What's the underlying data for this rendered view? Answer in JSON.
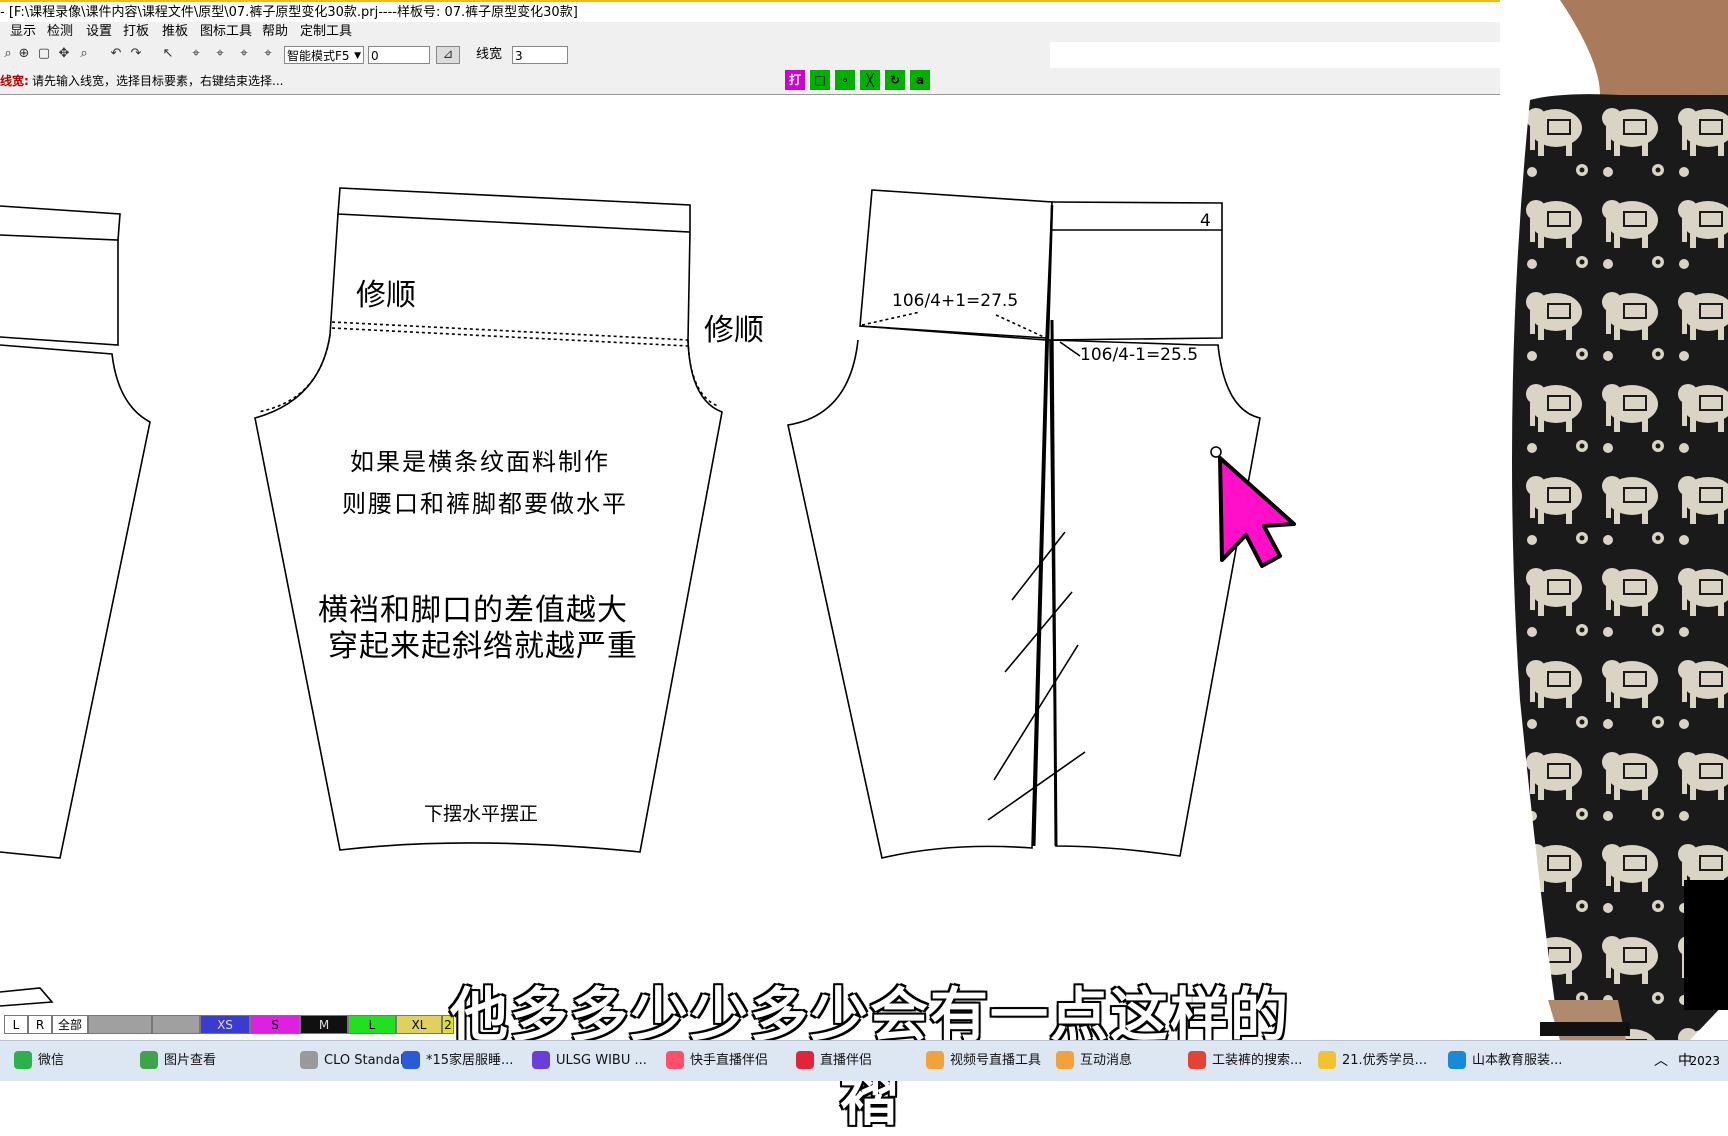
{
  "window": {
    "title": "- [F:\\课程录像\\课件内容\\课程文件\\原型\\07.裤子原型变化30款.prj----样板号: 07.裤子原型变化30款]"
  },
  "menu": {
    "items": [
      "显示",
      "检测",
      "设置",
      "打板",
      "推板",
      "图标工具",
      "帮助",
      "定制工具"
    ]
  },
  "toolbar": {
    "mode_select": "智能模式F5",
    "value_input": "0",
    "linewidth_label": "线宽",
    "linewidth_value": "3"
  },
  "status": {
    "label": "线宽:",
    "hint": "请先输入线宽，选择目标要素，右键结束选择..."
  },
  "snap_buttons": [
    {
      "glyph": "打",
      "color": "#d000d0"
    },
    {
      "glyph": "□",
      "color": "#00b000"
    },
    {
      "glyph": "∘",
      "color": "#00b000"
    },
    {
      "glyph": "╳",
      "color": "#00b000"
    },
    {
      "glyph": "↻",
      "color": "#00b000"
    },
    {
      "glyph": "a",
      "color": "#00b000"
    }
  ],
  "annotations": {
    "xiushun_left": "修顺",
    "xiushun_right": "修顺",
    "note1_line1": "如果是横条纹面料制作",
    "note1_line2": "则腰口和裤脚都要做水平",
    "note2_line1": "横裆和脚口的差值越大",
    "note2_line2": "穿起来起斜绺就越严重",
    "hem_note": "下摆水平摆正",
    "formula_back": "106/4+1=27.5",
    "formula_front": "106/4-1=25.5",
    "piece_number": "4"
  },
  "size_bar": {
    "cells": [
      "L",
      "R",
      "全部",
      "",
      "",
      "XS",
      "S",
      "M",
      "L",
      "XL",
      "2"
    ],
    "colors": [
      "#ffffff",
      "#ffffff",
      "#ffffff",
      "#a0a0a0",
      "#a0a0a0",
      "#3b3bd0",
      "#e020e0",
      "#101010",
      "#20e020",
      "#e0d060",
      "#e0e020"
    ]
  },
  "subtitle": "他多多少少多少会有一点这样的褶",
  "taskbar": {
    "items": [
      {
        "label": "微信",
        "color": "#2bb24c"
      },
      {
        "label": "图片查看",
        "color": "#3fa34d"
      },
      {
        "label": "CLO Standal...",
        "color": "#999999"
      },
      {
        "label": "*15家居服睡...",
        "color": "#2a5bd7"
      },
      {
        "label": "ULSG WIBU ...",
        "color": "#6a3fd8"
      },
      {
        "label": "快手直播伴侣",
        "color": "#ff4f6b"
      },
      {
        "label": "直播伴侣",
        "color": "#e0243a"
      },
      {
        "label": "视频号直播工具",
        "color": "#f2a23b"
      },
      {
        "label": "互动消息",
        "color": "#f2a23b"
      },
      {
        "label": "工装裤的搜索...",
        "color": "#e34234"
      },
      {
        "label": "21.优秀学员...",
        "color": "#f2c230"
      },
      {
        "label": "山本教育服装...",
        "color": "#1a8ad8"
      }
    ],
    "tray_time": "2023"
  }
}
